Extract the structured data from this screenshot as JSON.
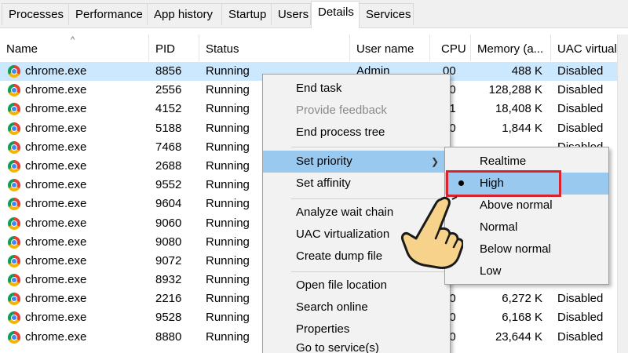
{
  "tabs": [
    {
      "label": "Processes"
    },
    {
      "label": "Performance"
    },
    {
      "label": "App history"
    },
    {
      "label": "Startup"
    },
    {
      "label": "Users"
    },
    {
      "label": "Details",
      "active": true
    },
    {
      "label": "Services"
    }
  ],
  "columns": {
    "name": "Name",
    "pid": "PID",
    "status": "Status",
    "user": "User name",
    "cpu": "CPU",
    "memory": "Memory (a...",
    "uac": "UAC virtualiz"
  },
  "sort_indicator": "^",
  "rows": [
    {
      "name": "chrome.exe",
      "pid": "8856",
      "status": "Running",
      "user": "Admin",
      "cpu": "00",
      "memory": "488 K",
      "uac": "Disabled",
      "selected": true
    },
    {
      "name": "chrome.exe",
      "pid": "2556",
      "status": "Running",
      "user": "",
      "cpu": "00",
      "memory": "128,288 K",
      "uac": "Disabled"
    },
    {
      "name": "chrome.exe",
      "pid": "4152",
      "status": "Running",
      "user": "",
      "cpu": "01",
      "memory": "18,408 K",
      "uac": "Disabled"
    },
    {
      "name": "chrome.exe",
      "pid": "5188",
      "status": "Running",
      "user": "",
      "cpu": "00",
      "memory": "1,844 K",
      "uac": "Disabled"
    },
    {
      "name": "chrome.exe",
      "pid": "7468",
      "status": "Running",
      "user": "",
      "cpu": "",
      "memory": "",
      "uac": "Disabled"
    },
    {
      "name": "chrome.exe",
      "pid": "2688",
      "status": "Running",
      "user": "",
      "cpu": "",
      "memory": "",
      "uac": ""
    },
    {
      "name": "chrome.exe",
      "pid": "9552",
      "status": "Running",
      "user": "",
      "cpu": "",
      "memory": "",
      "uac": ""
    },
    {
      "name": "chrome.exe",
      "pid": "9604",
      "status": "Running",
      "user": "",
      "cpu": "",
      "memory": "",
      "uac": ""
    },
    {
      "name": "chrome.exe",
      "pid": "9060",
      "status": "Running",
      "user": "",
      "cpu": "",
      "memory": "",
      "uac": ""
    },
    {
      "name": "chrome.exe",
      "pid": "9080",
      "status": "Running",
      "user": "",
      "cpu": "",
      "memory": "",
      "uac": ""
    },
    {
      "name": "chrome.exe",
      "pid": "9072",
      "status": "Running",
      "user": "",
      "cpu": "",
      "memory": "",
      "uac": ""
    },
    {
      "name": "chrome.exe",
      "pid": "8932",
      "status": "Running",
      "user": "",
      "cpu": "",
      "memory": "",
      "uac": ""
    },
    {
      "name": "chrome.exe",
      "pid": "2216",
      "status": "Running",
      "user": "",
      "cpu": "00",
      "memory": "6,272 K",
      "uac": "Disabled"
    },
    {
      "name": "chrome.exe",
      "pid": "9528",
      "status": "Running",
      "user": "",
      "cpu": "00",
      "memory": "6,168 K",
      "uac": "Disabled"
    },
    {
      "name": "chrome.exe",
      "pid": "8880",
      "status": "Running",
      "user": "",
      "cpu": "00",
      "memory": "23,644 K",
      "uac": "Disabled"
    }
  ],
  "context_menu": {
    "end_task": "End task",
    "provide_feedback": "Provide feedback",
    "end_process_tree": "End process tree",
    "set_priority": "Set priority",
    "set_affinity": "Set affinity",
    "analyze_wait_chain": "Analyze wait chain",
    "uac_virtualization": "UAC virtualization",
    "create_dump_file": "Create dump file",
    "open_file_location": "Open file location",
    "search_online": "Search online",
    "properties": "Properties",
    "go_to_services": "Go to service(s)"
  },
  "priority_menu": {
    "realtime": "Realtime",
    "high": "High",
    "above_normal": "Above normal",
    "normal": "Normal",
    "below_normal": "Below normal",
    "low": "Low",
    "selected": "High"
  },
  "colors": {
    "selected_row": "#cce8ff",
    "menu_hover": "#99c9ef",
    "highlight_border": "#d9232e"
  }
}
